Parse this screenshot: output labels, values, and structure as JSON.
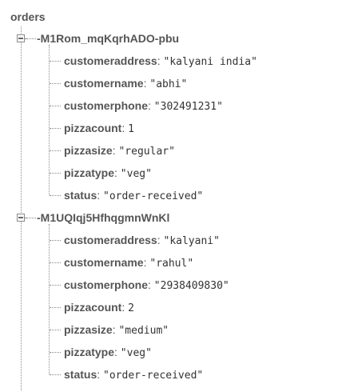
{
  "root": {
    "label": "orders"
  },
  "orders": [
    {
      "id": "-M1Rom_mqKqrhADO-pbu",
      "fields": [
        {
          "key": "customeraddress",
          "value": "\"kalyani india\""
        },
        {
          "key": "customername",
          "value": "\"abhi\""
        },
        {
          "key": "customerphone",
          "value": "\"302491231\""
        },
        {
          "key": "pizzacount",
          "value": "1"
        },
        {
          "key": "pizzasize",
          "value": "\"regular\""
        },
        {
          "key": "pizzatype",
          "value": "\"veg\""
        },
        {
          "key": "status",
          "value": "\"order-received\""
        }
      ]
    },
    {
      "id": "-M1UQIqj5HfhqgmnWnKl",
      "fields": [
        {
          "key": "customeraddress",
          "value": "\"kalyani\""
        },
        {
          "key": "customername",
          "value": "\"rahul\""
        },
        {
          "key": "customerphone",
          "value": "\"2938409830\""
        },
        {
          "key": "pizzacount",
          "value": "2"
        },
        {
          "key": "pizzasize",
          "value": "\"medium\""
        },
        {
          "key": "pizzatype",
          "value": "\"veg\""
        },
        {
          "key": "status",
          "value": "\"order-received\""
        }
      ]
    }
  ],
  "icons": {
    "collapse": "minus-box-icon"
  }
}
